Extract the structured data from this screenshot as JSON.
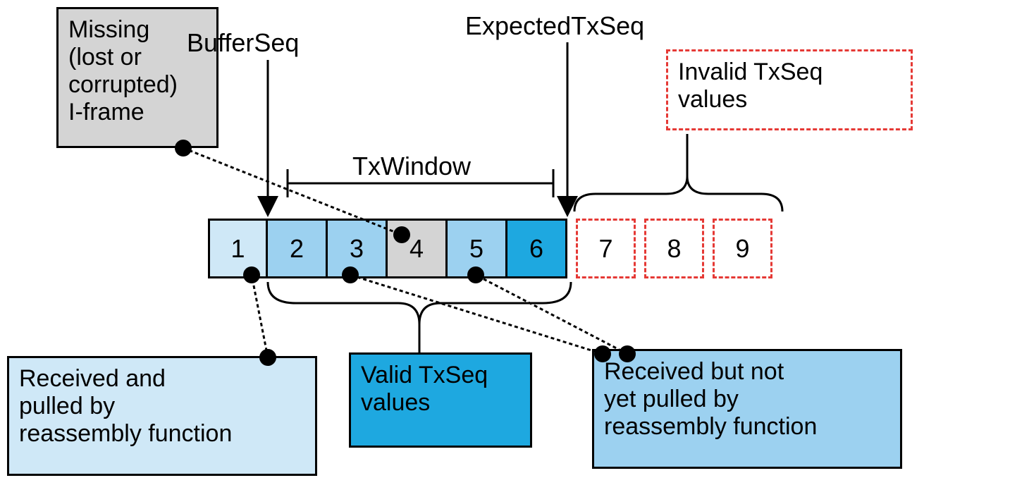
{
  "cells": {
    "c1": "1",
    "c2": "2",
    "c3": "3",
    "c4": "4",
    "c5": "5",
    "c6": "6",
    "c7": "7",
    "c8": "8",
    "c9": "9"
  },
  "boxes": {
    "missing": "Missing\n(lost or\ncorrupted)\nI-frame",
    "invalid": "Invalid TxSeq\nvalues",
    "received_pulled": "Received and\npulled by\nreassembly function",
    "valid": "Valid TxSeq\nvalues",
    "received_notpulled": "Received but not\nyet pulled by\nreassembly function"
  },
  "labels": {
    "bufferseq": "BufferSeq",
    "expected": "ExpectedTxSeq",
    "txwindow": "TxWindow"
  }
}
